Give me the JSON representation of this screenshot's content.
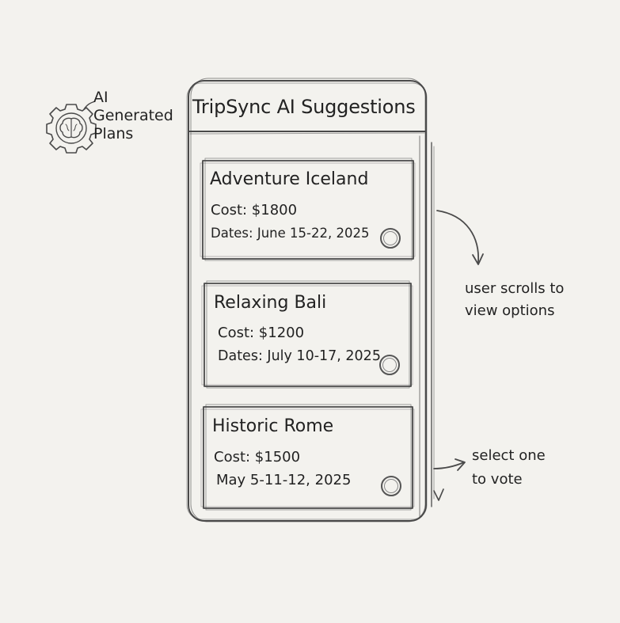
{
  "annotation_ai": {
    "line1": "AI",
    "line2": "Generated",
    "line3": "Plans",
    "icon": "brain-gear-icon"
  },
  "phone": {
    "title": "TripSync AI Suggestions"
  },
  "cards": [
    {
      "title": "Adventure Iceland",
      "cost": "Cost: $1800",
      "dates": "Dates: June 15-22, 2025"
    },
    {
      "title": "Relaxing Bali",
      "cost": "Cost: $1200",
      "dates": "Dates: July 10-17, 2025"
    },
    {
      "title": "Historic Rome",
      "cost": "Cost: $1500",
      "dates": "May 5-11-12, 2025"
    }
  ],
  "notes": {
    "scroll_line1": "user scrolls to",
    "scroll_line2": "view options",
    "vote_line1": "select one",
    "vote_line2": "to vote"
  },
  "colors": {
    "paper": "#f3f2ee",
    "ink": "#2b2b2b",
    "pencil": "#555555"
  }
}
